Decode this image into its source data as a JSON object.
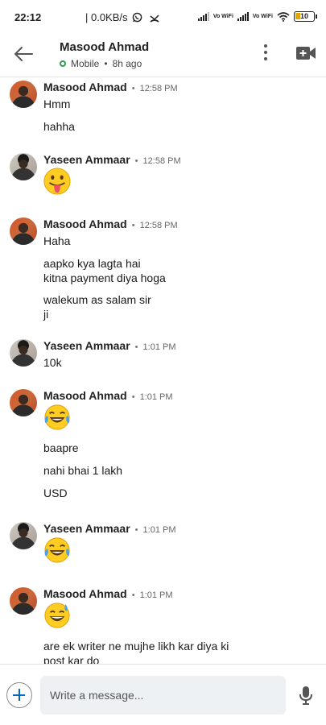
{
  "status_bar": {
    "time": "22:12",
    "speed": "| 0.0KB/s",
    "network_labels": [
      "Vo WiFi",
      "Vo WiFi"
    ],
    "battery": "10",
    "icons": [
      "whatsapp-icon",
      "missed-call-icon",
      "signal-icon",
      "signal-icon",
      "wifi-icon",
      "battery-icon"
    ]
  },
  "header": {
    "contact_name": "Masood Ahmad",
    "presence": "Mobile",
    "last_seen": "8h ago",
    "icons": [
      "back-arrow-icon",
      "more-vertical-icon",
      "video-call-icon"
    ]
  },
  "messages": [
    {
      "sender": "Masood Ahmad",
      "time": "12:58 PM",
      "lines": [
        "Hmm",
        "hahha"
      ]
    },
    {
      "sender": "Yaseen Ammaar",
      "time": "12:58 PM",
      "lines": [],
      "emoji": "tongue-out-emoji"
    },
    {
      "sender": "Masood Ahmad",
      "time": "12:58 PM",
      "lines": [
        "Haha",
        "aapko kya lagta hai",
        "kitna payment diya hoga",
        "walekum as salam sir",
        "ji"
      ]
    },
    {
      "sender": "Yaseen Ammaar",
      "time": "1:01 PM",
      "lines": [
        "10k"
      ]
    },
    {
      "sender": "Masood Ahmad",
      "time": "1:01 PM",
      "emoji": "tears-of-joy-emoji",
      "lines": [
        "baapre",
        "nahi bhai 1 lakh",
        "USD"
      ]
    },
    {
      "sender": "Yaseen Ammaar",
      "time": "1:01 PM",
      "lines": [],
      "emoji": "tears-of-joy-emoji"
    },
    {
      "sender": "Masood Ahmad",
      "time": "1:01 PM",
      "emoji": "grinning-sweat-emoji",
      "lines": [
        "are ek writer ne mujhe likh kar diya ki",
        "post kar do"
      ]
    }
  ],
  "composer": {
    "placeholder": "Write a message...",
    "icons": [
      "add-icon",
      "microphone-icon"
    ]
  },
  "colors": {
    "accent": "#0a66c2",
    "online": "#2e9e4d",
    "input_bg": "#eef1f4"
  }
}
